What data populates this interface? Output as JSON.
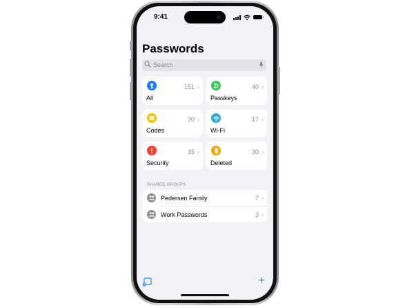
{
  "status": {
    "time": "9:41"
  },
  "title": "Passwords",
  "search": {
    "placeholder": "Search"
  },
  "categories": [
    {
      "label": "All",
      "count": "151",
      "icon": "key-icon",
      "color": "#1a7cf2"
    },
    {
      "label": "Passkeys",
      "count": "40",
      "icon": "passkey-icon",
      "color": "#34c759"
    },
    {
      "label": "Codes",
      "count": "20",
      "icon": "code-icon",
      "color": "#f5c400"
    },
    {
      "label": "Wi-Fi",
      "count": "17",
      "icon": "wifi-icon",
      "color": "#30aadc"
    },
    {
      "label": "Security",
      "count": "35",
      "icon": "exclamation-icon",
      "color": "#ff3b30"
    },
    {
      "label": "Deleted",
      "count": "30",
      "icon": "trash-icon",
      "color": "#ff9f0a"
    }
  ],
  "shared": {
    "header": "SHARED GROUPS",
    "groups": [
      {
        "name": "Pedersen Family",
        "count": "7",
        "icon": "group-icon"
      },
      {
        "name": "Work Passwords",
        "count": "3",
        "icon": "group-icon"
      }
    ]
  },
  "toolbar": {
    "new_item": "+",
    "left_icon": "shared-group-add-icon"
  }
}
